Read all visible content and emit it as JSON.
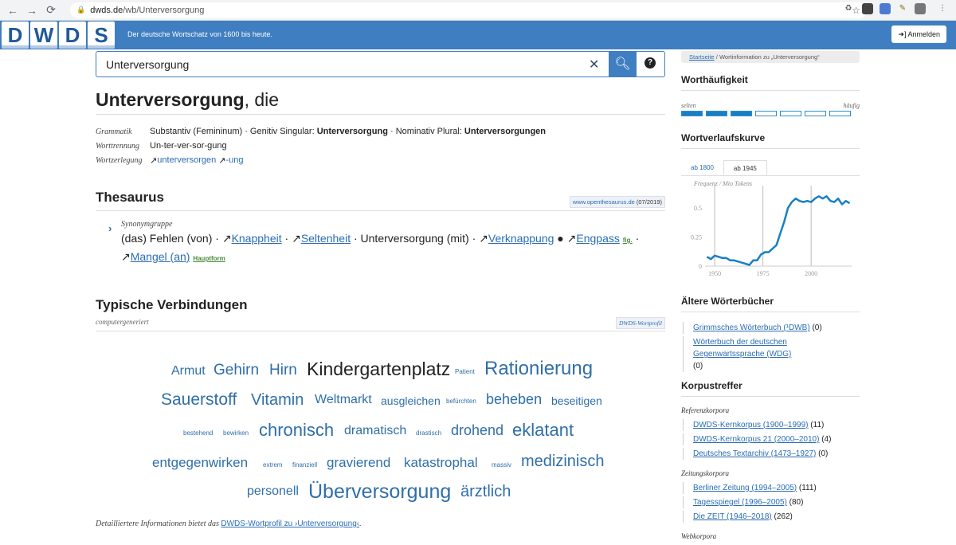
{
  "browser": {
    "url_host": "dwds.de",
    "url_path": "/wb/Unterversorgung"
  },
  "header": {
    "logo_letters": [
      "D",
      "W",
      "D",
      "S"
    ],
    "tagline": "Der deutsche Wortschatz von 1600 bis heute.",
    "login_label": "Anmelden"
  },
  "search": {
    "value": "Unterversorgung"
  },
  "lemma": {
    "word": "Unterversorgung",
    "article": ", die"
  },
  "grammar": {
    "rows": [
      {
        "key": "Grammatik",
        "text1": "Substantiv (Femininum) · Genitiv Singular: ",
        "b1": "Unterversorgung",
        "text2": " · Nominativ Plural: ",
        "b2": "Unterversorgungen"
      },
      {
        "key": "Worttrennung",
        "value": "Un-ter-ver-sor-gung"
      },
      {
        "key": "Wortzerlegung",
        "link1": "unterversorgen",
        "link2": "-ung"
      }
    ]
  },
  "thesaurus": {
    "heading": "Thesaurus",
    "source_site": "www.openthesaurus.de",
    "source_date": "(07/2019)",
    "group_label": "Synonymgruppe",
    "line1": {
      "plain1": "(das) Fehlen (von) · ",
      "link1": "Knappheit",
      "sep1": " · ",
      "link2": "Seltenheit",
      "plain2": " · Unterversorgung (mit) · ",
      "link3": "Verknappung",
      "bullet": " ● ",
      "link4": "Engpass",
      "tag1": "fig.",
      "end": " ·"
    },
    "line2": {
      "link5": "Mangel (an)",
      "tag2": "Hauptform"
    }
  },
  "collocations": {
    "heading": "Typische Verbindungen",
    "note": "computergeneriert",
    "source": "DWDS-Wortprofil",
    "words": [
      {
        "w": "Armut",
        "s": 16,
        "c": "#2f6fa8"
      },
      {
        "w": "Gehirn",
        "s": 19,
        "c": "#2f6fa8"
      },
      {
        "w": "Hirn",
        "s": 19,
        "c": "#2f6fa8"
      },
      {
        "w": "Kindergartenplatz",
        "s": 23,
        "c": "#222"
      },
      {
        "w": "Patient",
        "s": 8,
        "c": "#2f6fa8"
      },
      {
        "w": "Rationierung",
        "s": 24,
        "c": "#2f6fa8"
      },
      {
        "w": "Sauerstoff",
        "s": 21,
        "c": "#2f6fa8"
      },
      {
        "w": "Vitamin",
        "s": 20,
        "c": "#2f6fa8"
      },
      {
        "w": "Weltmarkt",
        "s": 16,
        "c": "#2f6fa8"
      },
      {
        "w": "ausgleichen",
        "s": 14,
        "c": "#2f6fa8"
      },
      {
        "w": "befürchten",
        "s": 8,
        "c": "#2f6fa8"
      },
      {
        "w": "beheben",
        "s": 18,
        "c": "#2f6fa8"
      },
      {
        "w": "beseitigen",
        "s": 14,
        "c": "#2f6fa8"
      },
      {
        "w": "bestehend",
        "s": 8,
        "c": "#2f6fa8"
      },
      {
        "w": "bewirken",
        "s": 8,
        "c": "#2f6fa8"
      },
      {
        "w": "chronisch",
        "s": 22,
        "c": "#2f6fa8"
      },
      {
        "w": "dramatisch",
        "s": 16,
        "c": "#2f6fa8"
      },
      {
        "w": "drastisch",
        "s": 8,
        "c": "#2f6fa8"
      },
      {
        "w": "drohend",
        "s": 18,
        "c": "#2f6fa8"
      },
      {
        "w": "eklatant",
        "s": 22,
        "c": "#2f6fa8"
      },
      {
        "w": "entgegenwirken",
        "s": 17,
        "c": "#2f6fa8"
      },
      {
        "w": "extrem",
        "s": 8,
        "c": "#2f6fa8"
      },
      {
        "w": "finanziell",
        "s": 8,
        "c": "#2f6fa8"
      },
      {
        "w": "gravierend",
        "s": 17,
        "c": "#2f6fa8"
      },
      {
        "w": "katastrophal",
        "s": 17,
        "c": "#2f6fa8"
      },
      {
        "w": "massiv",
        "s": 8,
        "c": "#2f6fa8"
      },
      {
        "w": "medizinisch",
        "s": 20,
        "c": "#2f6fa8"
      },
      {
        "w": "personell",
        "s": 16,
        "c": "#2f6fa8"
      },
      {
        "w": "Überversorgung",
        "s": 25,
        "c": "#2f6fa8"
      },
      {
        "w": "ärztlich",
        "s": 20,
        "c": "#2f6fa8"
      }
    ]
  },
  "footer": {
    "text": "Detailliertere Informationen bietet das ",
    "link": "DWDS-Wortprofil zu ›Unterversorgung‹",
    "end": "."
  },
  "sidebar": {
    "breadcrumb_home": "Startseite",
    "breadcrumb_current": "Wortinformation zu „Unterversorgung“",
    "freq_heading": "Worthäufigkeit",
    "freq_low": "selten",
    "freq_high": "häufig",
    "freq_level": 3,
    "freq_max": 7,
    "curve_heading": "Wortverlaufskurve",
    "tab1": "ab 1800",
    "tab2": "ab 1945",
    "older_heading": "Ältere Wörterbücher",
    "corpus_heading": "Korpustreffer",
    "cat_ref": "Referenzkorpora",
    "cat_news": "Zeitungskorpora",
    "cat_web": "Webkorpora",
    "older": [
      {
        "link": "Grimmsches Wörterbuch (¹DWB)",
        "count": "(0)"
      },
      {
        "link": "Wörterbuch der deutschen Gegenwartssprache (WDG)",
        "count": "(0)"
      }
    ],
    "ref": [
      {
        "link": "DWDS-Kernkorpus (1900–1999)",
        "count": "(11)"
      },
      {
        "link": "DWDS-Kernkorpus 21 (2000–2010)",
        "count": "(4)"
      },
      {
        "link": "Deutsches Textarchiv (1473–1927)",
        "count": "(0)"
      }
    ],
    "news": [
      {
        "link": "Berliner Zeitung (1994–2005)",
        "count": "(111)"
      },
      {
        "link": "Tagesspiegel (1996–2005)",
        "count": "(80)"
      },
      {
        "link": "Die ZEIT (1946–2018)",
        "count": "(262)"
      }
    ]
  },
  "chart_data": {
    "type": "line",
    "ylabel": "Frequenz / Mio Tokens",
    "ylim": [
      0,
      0.65
    ],
    "xlim": [
      1945,
      2021
    ],
    "xticks": [
      1950,
      1975,
      2000
    ],
    "yticks": [
      0,
      0.25,
      0.5
    ],
    "ytick_labels": [
      "0",
      "0.25",
      "0.5"
    ],
    "color": "#1a7fc2",
    "series": [
      {
        "x": [
          1946,
          1948,
          1950,
          1952,
          1954,
          1956,
          1958,
          1960,
          1962,
          1964,
          1966,
          1968,
          1970,
          1972,
          1974,
          1976,
          1978,
          1980,
          1982,
          1984,
          1986,
          1988,
          1990,
          1992,
          1994,
          1996,
          1998,
          2000,
          2002,
          2004,
          2006,
          2008,
          2010,
          2012,
          2014,
          2016,
          2018,
          2020
        ],
        "y": [
          0.08,
          0.06,
          0.09,
          0.08,
          0.07,
          0.07,
          0.05,
          0.05,
          0.04,
          0.03,
          0.02,
          0.01,
          0.05,
          0.05,
          0.1,
          0.12,
          0.12,
          0.15,
          0.18,
          0.28,
          0.38,
          0.5,
          0.55,
          0.58,
          0.56,
          0.55,
          0.56,
          0.55,
          0.58,
          0.6,
          0.58,
          0.6,
          0.56,
          0.55,
          0.58,
          0.53,
          0.56,
          0.54
        ]
      }
    ]
  }
}
